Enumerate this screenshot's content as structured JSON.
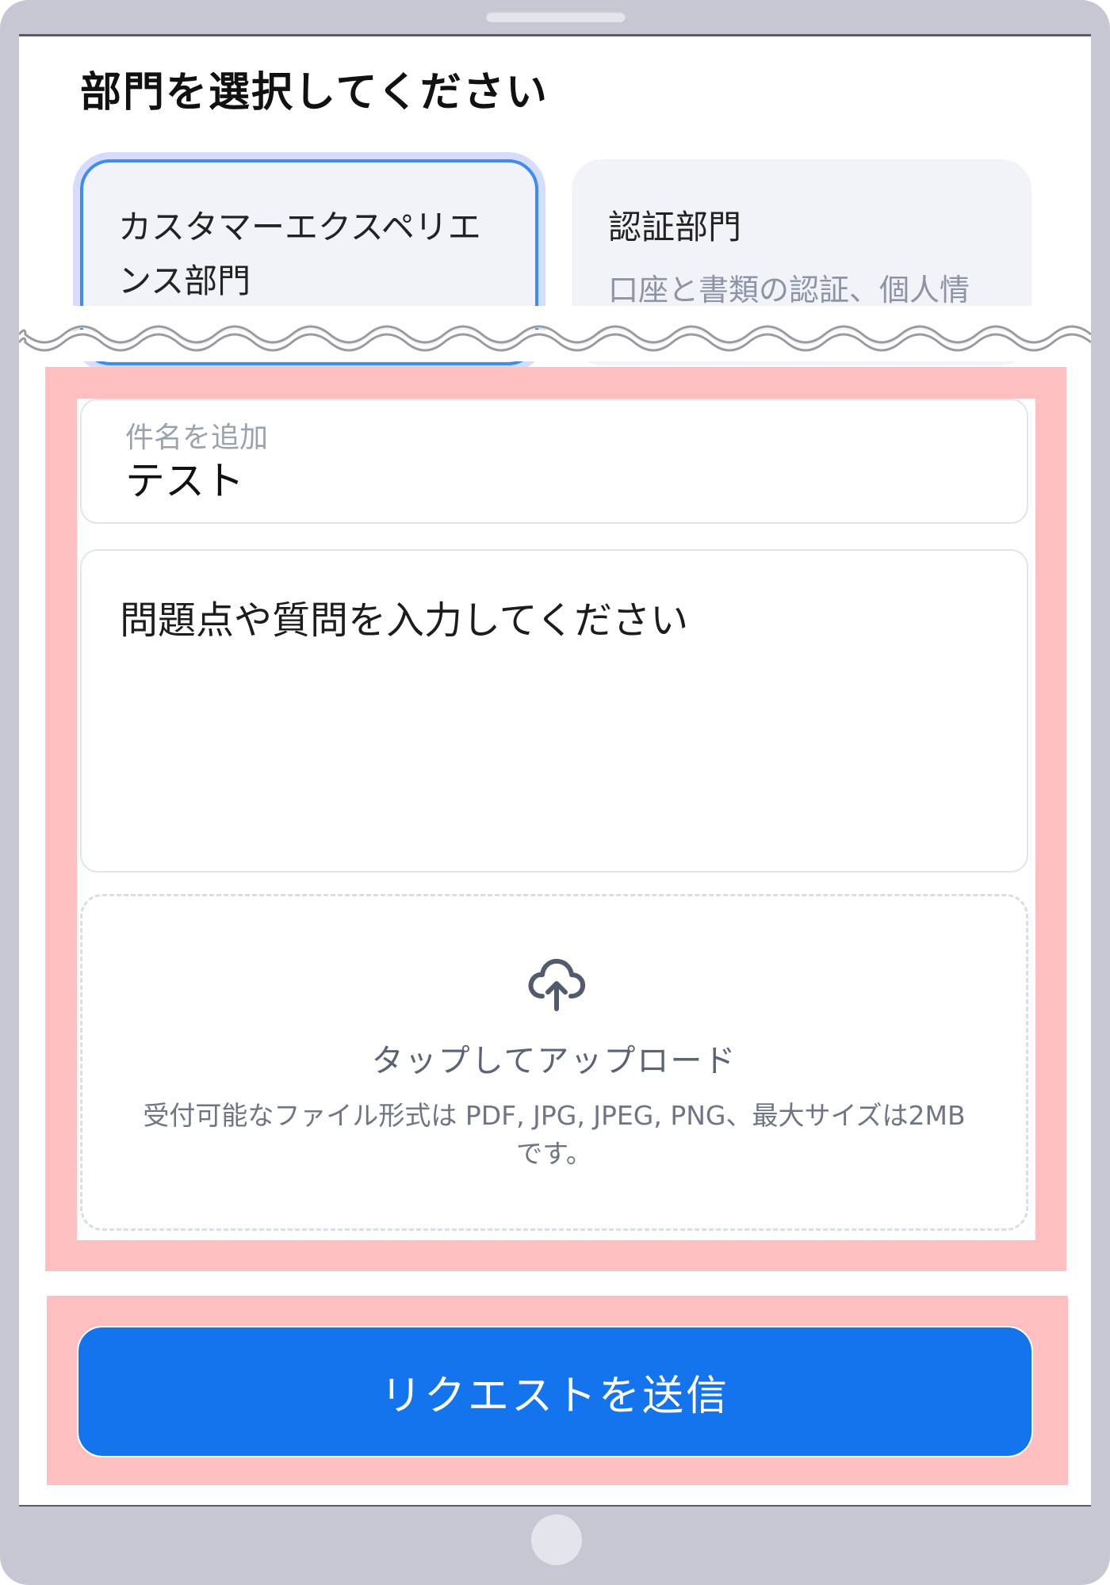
{
  "page_title": "部門を選択してください",
  "departments": [
    {
      "name": "カスタマーエクスペリエンス部門",
      "description": "",
      "selected": true
    },
    {
      "name": "認証部門",
      "description": "口座と書類の認証、個人情",
      "selected": false
    }
  ],
  "subject": {
    "label": "件名を追加",
    "value": "テスト"
  },
  "message": {
    "placeholder": "問題点や質問を入力してください"
  },
  "upload": {
    "icon": "cloud-upload-icon",
    "title": "タップしてアップロード",
    "note": "受付可能なファイル形式は PDF, JPG, JPEG, PNG、最大サイズは2MBです。"
  },
  "submit": {
    "label": "リクエストを送信"
  },
  "colors": {
    "primary": "#1474ee",
    "selected_border": "#3f8bf0",
    "highlight": "#ffbfc0",
    "device_frame": "#c6c7d3"
  }
}
